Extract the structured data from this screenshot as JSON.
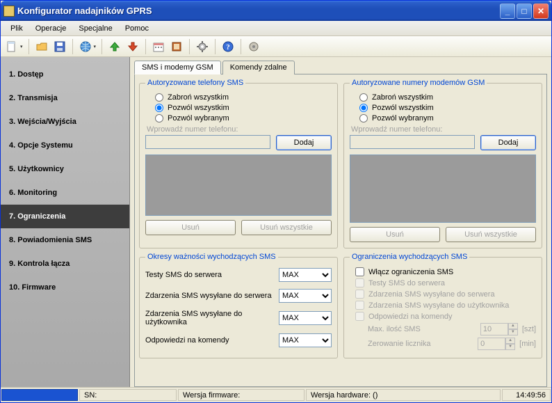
{
  "window": {
    "title": "Konfigurator nadajników GPRS"
  },
  "menu": {
    "file": "Plik",
    "ops": "Operacje",
    "special": "Specjalne",
    "help": "Pomoc"
  },
  "toolbar_icons": [
    "new",
    "open",
    "save",
    "globe",
    "up",
    "down",
    "calendar",
    "book",
    "gear",
    "help",
    "app"
  ],
  "sidebar": {
    "items": [
      {
        "label": "1. Dostęp"
      },
      {
        "label": "2. Transmisja"
      },
      {
        "label": "3. Wejścia/Wyjścia"
      },
      {
        "label": "4. Opcje Systemu"
      },
      {
        "label": "5. Użytkownicy"
      },
      {
        "label": "6. Monitoring"
      },
      {
        "label": "7. Ograniczenia"
      },
      {
        "label": "8. Powiadomienia SMS"
      },
      {
        "label": "9. Kontrola łącza"
      },
      {
        "label": "10. Firmware"
      }
    ],
    "active_index": 6
  },
  "tabs": {
    "tab1": "SMS i modemy GSM",
    "tab2": "Komendy zdalne"
  },
  "group_sms": {
    "legend": "Autoryzowane telefony SMS",
    "opt1": "Zabroń wszystkim",
    "opt2": "Pozwól wszystkim",
    "opt3": "Pozwól wybranym",
    "input_label": "Wprowadź numer telefonu:",
    "add": "Dodaj",
    "remove": "Usuń",
    "remove_all": "Usuń wszystkie"
  },
  "group_gsm": {
    "legend": "Autoryzowane numery modemów GSM",
    "opt1": "Zabroń wszystkim",
    "opt2": "Pozwól wszystkim",
    "opt3": "Pozwól wybranym",
    "input_label": "Wprowadź numer telefonu:",
    "add": "Dodaj",
    "remove": "Usuń",
    "remove_all": "Usuń wszystkie"
  },
  "group_periods": {
    "legend": "Okresy ważności wychodzących SMS",
    "row1": "Testy SMS do serwera",
    "row2": "Zdarzenia SMS wysyłane do serwera",
    "row3": "Zdarzenia SMS wysyłane do użytkownika",
    "row4": "Odpowiedzi na komendy",
    "value": "MAX"
  },
  "group_limits": {
    "legend": "Ograniczenia wychodzących SMS",
    "enable": "Włącz ograniczenia SMS",
    "c1": "Testy SMS do serwera",
    "c2": "Zdarzenia SMS wysyłane do serwera",
    "c3": "Zdarzenia SMS wysyłane do użytkownika",
    "c4": "Odpowiedzi na komendy",
    "max_label": "Max. ilość SMS",
    "max_value": "10",
    "max_unit": "[szt]",
    "reset_label": "Zerowanie licznika",
    "reset_value": "0",
    "reset_unit": "[min]"
  },
  "status": {
    "sn_label": "SN:",
    "fw_label": "Wersja firmware:",
    "hw_label": "Wersja hardware: ()",
    "time": "14:49:56"
  }
}
